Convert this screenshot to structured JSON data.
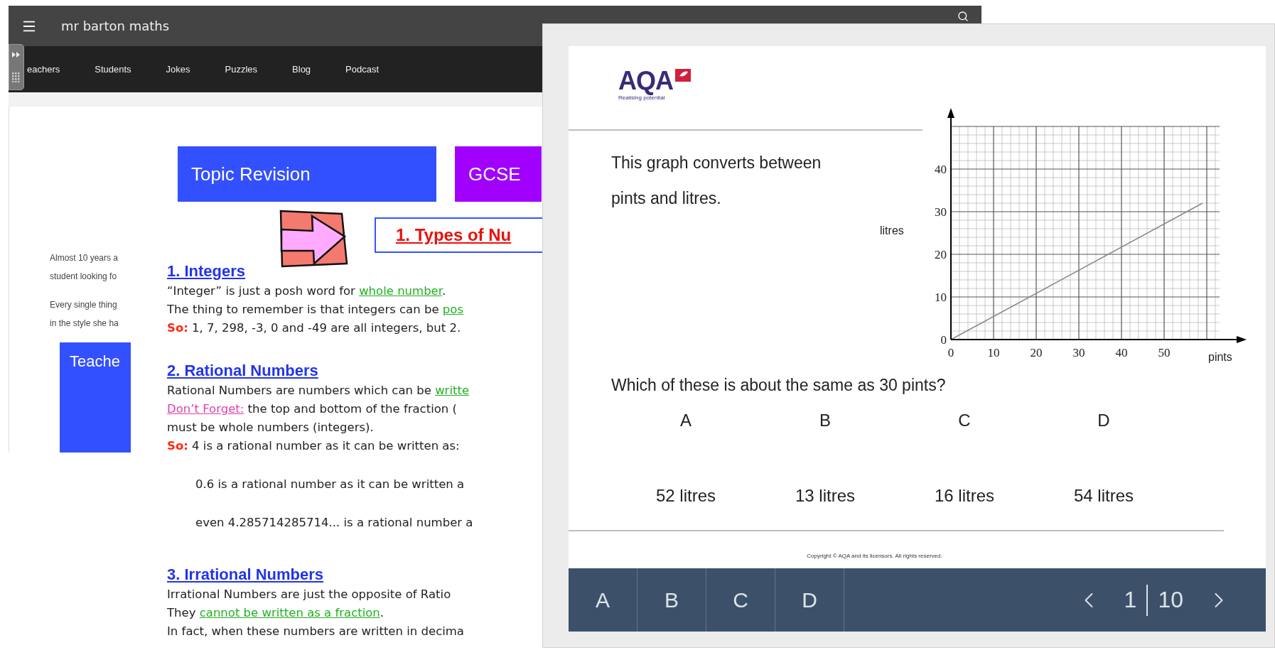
{
  "browser_page": {
    "header": {
      "title": "mr barton maths"
    },
    "nav": {
      "items": [
        "eachers",
        "Students",
        "Jokes",
        "Puzzles",
        "Blog",
        "Podcast"
      ]
    },
    "sidebar": {
      "paragraphs": [
        [
          "Almost 10 years a",
          "student looking fo"
        ],
        [
          "Every single thing",
          "in the style she ha"
        ]
      ],
      "button": "Teache"
    },
    "banner_buttons": [
      {
        "label": "Topic Revision",
        "color": "#3350ff"
      },
      {
        "label": "GCSE",
        "color": "#a100ff"
      }
    ],
    "title": "1. Types of Nu",
    "sections": [
      {
        "heading": "1. Integers",
        "lines": [
          {
            "kind": "normal",
            "parts": [
              {
                "kind": "plain",
                "text": "“Integer” is just a posh word for "
              },
              {
                "kind": "link",
                "text": "whole number"
              },
              {
                "kind": "plain",
                "text": "."
              }
            ]
          },
          {
            "kind": "normal",
            "parts": [
              {
                "kind": "plain",
                "text": "The thing to remember is that integers can be "
              },
              {
                "kind": "link",
                "text": "pos"
              }
            ]
          },
          {
            "kind": "normal",
            "parts": [
              {
                "kind": "label",
                "text": "So:"
              },
              {
                "kind": "plain",
                "text": " 1, 7, 298, -3, 0 and -49 are all integers, but 2."
              }
            ]
          }
        ]
      },
      {
        "heading": "2. Rational Numbers",
        "lines": [
          {
            "kind": "normal",
            "parts": [
              {
                "kind": "plain",
                "text": "Rational Numbers are numbers which can be "
              },
              {
                "kind": "link",
                "text": "writte"
              }
            ]
          },
          {
            "kind": "normal",
            "parts": [
              {
                "kind": "reminder",
                "text": "Don’t Forget:"
              },
              {
                "kind": "plain",
                "text": " the top and bottom of the fraction ("
              }
            ]
          },
          {
            "kind": "normal",
            "parts": [
              {
                "kind": "plain",
                "text": "must be whole numbers (integers)."
              }
            ]
          },
          {
            "kind": "normal",
            "parts": [
              {
                "kind": "label",
                "text": "So:"
              },
              {
                "kind": "plain",
                "text": " 4 is a rational number as it can be written as:"
              }
            ]
          },
          {
            "kind": "indented",
            "parts": [
              {
                "kind": "plain",
                "text": "0.6 is a rational number as it can be written a"
              }
            ]
          },
          {
            "kind": "indented",
            "parts": [
              {
                "kind": "plain",
                "text": "even 4.285714285714... is a rational number a"
              }
            ]
          }
        ]
      },
      {
        "heading": "3. Irrational Numbers",
        "lines": [
          {
            "kind": "normal",
            "parts": [
              {
                "kind": "plain",
                "text": "Irrational Numbers are just the opposite of Ratio"
              }
            ]
          },
          {
            "kind": "normal",
            "parts": [
              {
                "kind": "plain",
                "text": "They "
              },
              {
                "kind": "link",
                "text": "cannot be written as a fraction"
              },
              {
                "kind": "plain",
                "text": "."
              }
            ]
          },
          {
            "kind": "normal",
            "parts": [
              {
                "kind": "plain",
                "text": "In fact, when these numbers are written in decima"
              }
            ]
          }
        ]
      }
    ]
  },
  "quiz": {
    "logo": {
      "name": "AQA",
      "tagline": "Realising potential"
    },
    "prompt_lines": [
      "This graph converts between",
      "pints and litres."
    ],
    "chart_data": {
      "type": "line",
      "xlabel": "pints",
      "ylabel": "litres",
      "x": [
        0,
        59
      ],
      "series": [
        {
          "color": "#8a8a8a",
          "values": [
            0,
            32
          ]
        }
      ],
      "grid": true,
      "xlim": [
        0,
        63
      ],
      "ylim": [
        0,
        50
      ],
      "xticks": [
        0,
        10,
        20,
        30,
        40,
        50
      ],
      "yticks": [
        0,
        10,
        20,
        30,
        40
      ]
    },
    "question": "Which of these is about the same as 30 pints?",
    "options": [
      {
        "letter": "A",
        "answer": "52 litres"
      },
      {
        "letter": "B",
        "answer": "13 litres"
      },
      {
        "letter": "C",
        "answer": "16 litres"
      },
      {
        "letter": "D",
        "answer": "54 litres"
      }
    ],
    "copyright": "Copyright © AQA and its licensors. All rights reserved.",
    "answer_buttons": [
      "A",
      "B",
      "C",
      "D"
    ],
    "pager": {
      "current": "1",
      "total": "10"
    }
  }
}
